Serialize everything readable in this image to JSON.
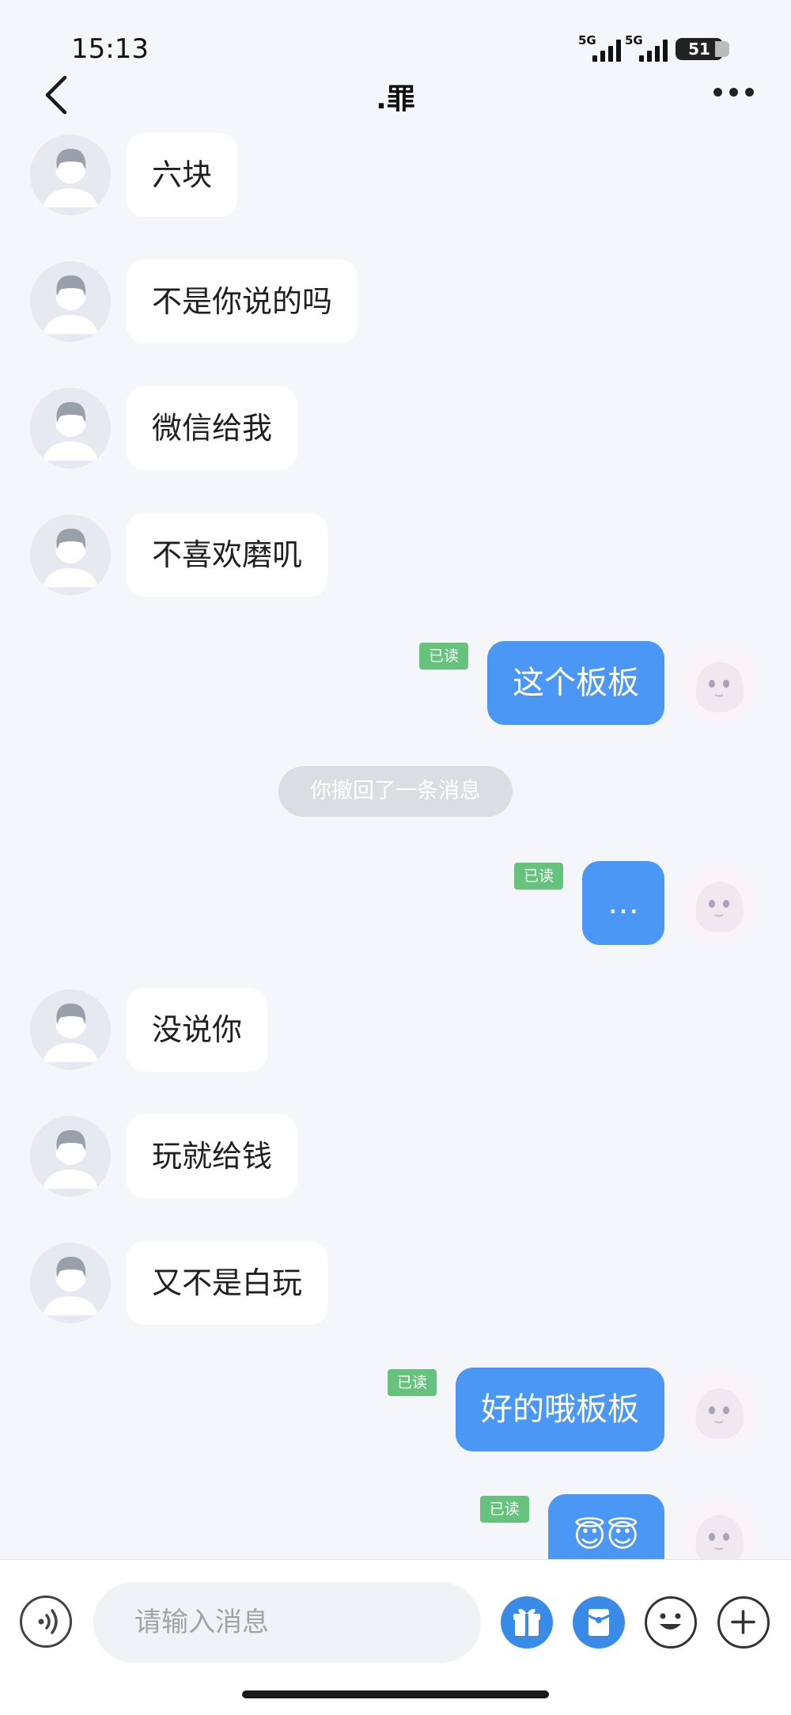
{
  "status": {
    "time": "15:13",
    "battery": "51",
    "sig1": "5G",
    "sig2": "5G"
  },
  "header": {
    "title": ".罪"
  },
  "messages": [
    {
      "side": "in",
      "text": "六块"
    },
    {
      "side": "in",
      "text": "不是你说的吗"
    },
    {
      "side": "in",
      "text": "微信给我"
    },
    {
      "side": "in",
      "text": "不喜欢磨叽"
    },
    {
      "side": "out",
      "text": "这个板板",
      "read": "已读"
    },
    {
      "side": "system",
      "text": "你撤回了一条消息"
    },
    {
      "side": "out",
      "text": "…",
      "read": "已读"
    },
    {
      "side": "in",
      "text": "没说你"
    },
    {
      "side": "in",
      "text": "玩就给钱"
    },
    {
      "side": "in",
      "text": "又不是白玩"
    },
    {
      "side": "out",
      "text": "好的哦板板",
      "read": "已读"
    },
    {
      "side": "out",
      "text": "😇😇",
      "read": "已读"
    }
  ],
  "input": {
    "placeholder": "请输入消息"
  },
  "icons": {
    "voice": "voice-icon",
    "gift": "gift-icon",
    "redpacket": "red-packet-icon",
    "emoji": "emoji-icon",
    "plus": "plus-icon"
  },
  "colors": {
    "accent": "#4a97f5",
    "read_badge": "#66c27c",
    "background": "#f4f6f9"
  }
}
